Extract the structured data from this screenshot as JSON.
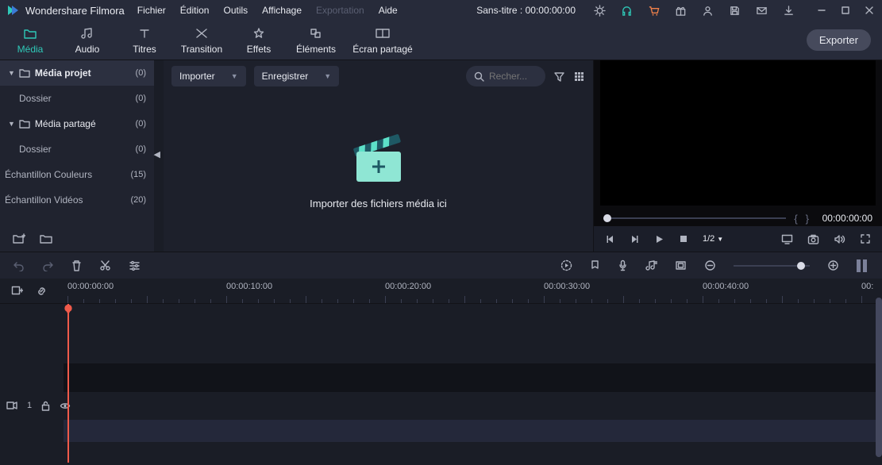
{
  "app": {
    "name": "Wondershare Filmora"
  },
  "menu": {
    "file": "Fichier",
    "edit": "Édition",
    "tools": "Outils",
    "view": "Affichage",
    "export": "Exportation",
    "help": "Aide"
  },
  "project": {
    "title": "Sans-titre",
    "timecode": "00:00:00:00"
  },
  "tabs": {
    "media": "Média",
    "audio": "Audio",
    "titles": "Titres",
    "transition": "Transition",
    "effects": "Effets",
    "elements": "Éléments",
    "splitscreen": "Écran partagé"
  },
  "export_btn": "Exporter",
  "sidebar": {
    "project": {
      "label": "Média projet",
      "count": "(0)"
    },
    "project_folder": {
      "label": "Dossier",
      "count": "(0)"
    },
    "shared": {
      "label": "Média partagé",
      "count": "(0)"
    },
    "shared_folder": {
      "label": "Dossier",
      "count": "(0)"
    },
    "colors": {
      "label": "Échantillon Couleurs",
      "count": "(15)"
    },
    "videos": {
      "label": "Échantillon Vidéos",
      "count": "(20)"
    }
  },
  "media": {
    "import": "Importer",
    "record": "Enregistrer",
    "search_placeholder": "Recher...",
    "drop_text": "Importer des fichiers média ici"
  },
  "preview": {
    "time": "00:00:00:00",
    "ratio": "1/2"
  },
  "ruler": {
    "t0": "00:00:00:00",
    "t1": "00:00:10:00",
    "t2": "00:00:20:00",
    "t3": "00:00:30:00",
    "t4": "00:00:40:00",
    "tclip": "00:"
  },
  "track": {
    "label": "1"
  }
}
